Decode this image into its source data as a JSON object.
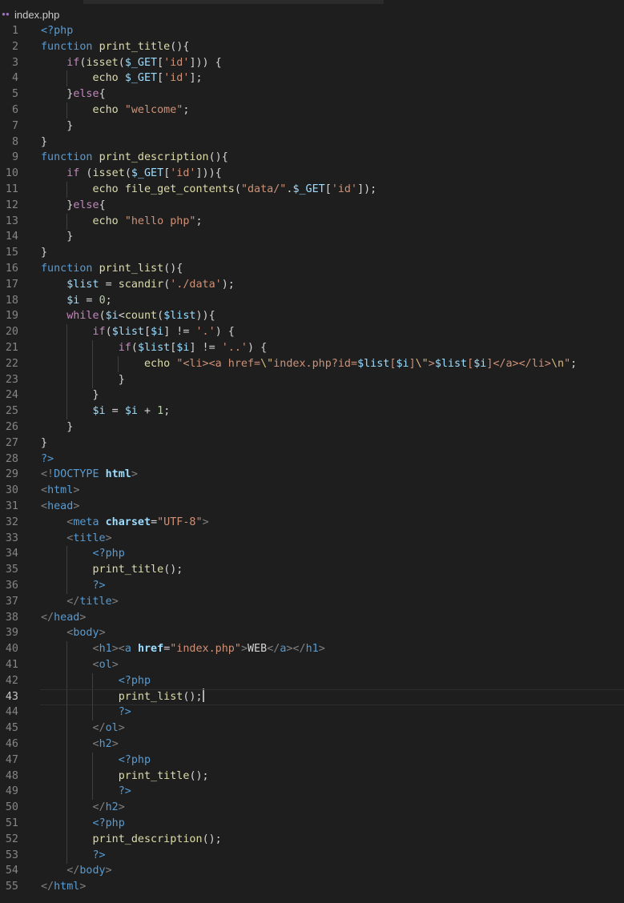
{
  "tab": {
    "icon": "php-elephant-icon",
    "title": "index.php"
  },
  "editor": {
    "language": "php",
    "active_line": 43,
    "lines": [
      [
        [
          "kw",
          "<?php"
        ]
      ],
      [
        [
          "kw",
          "function"
        ],
        [
          "plain",
          " "
        ],
        [
          "fn",
          "print_title"
        ],
        [
          "plain",
          "(){"
        ]
      ],
      [
        [
          "plain",
          "    "
        ],
        [
          "ctl",
          "if"
        ],
        [
          "plain",
          "("
        ],
        [
          "fn",
          "isset"
        ],
        [
          "plain",
          "("
        ],
        [
          "var",
          "$_GET"
        ],
        [
          "plain",
          "["
        ],
        [
          "str",
          "'id'"
        ],
        [
          "plain",
          "])) {"
        ]
      ],
      [
        [
          "plain",
          "        "
        ],
        [
          "fn",
          "echo"
        ],
        [
          "plain",
          " "
        ],
        [
          "var",
          "$_GET"
        ],
        [
          "plain",
          "["
        ],
        [
          "str",
          "'id'"
        ],
        [
          "plain",
          "];"
        ]
      ],
      [
        [
          "plain",
          "    }"
        ],
        [
          "ctl",
          "else"
        ],
        [
          "plain",
          "{"
        ]
      ],
      [
        [
          "plain",
          "        "
        ],
        [
          "fn",
          "echo"
        ],
        [
          "plain",
          " "
        ],
        [
          "str",
          "\"welcome\""
        ],
        [
          "plain",
          ";"
        ]
      ],
      [
        [
          "plain",
          "    }"
        ]
      ],
      [
        [
          "plain",
          "}"
        ]
      ],
      [
        [
          "kw",
          "function"
        ],
        [
          "plain",
          " "
        ],
        [
          "fn",
          "print_description"
        ],
        [
          "plain",
          "(){"
        ]
      ],
      [
        [
          "plain",
          "    "
        ],
        [
          "ctl",
          "if"
        ],
        [
          "plain",
          " ("
        ],
        [
          "fn",
          "isset"
        ],
        [
          "plain",
          "("
        ],
        [
          "var",
          "$_GET"
        ],
        [
          "plain",
          "["
        ],
        [
          "str",
          "'id'"
        ],
        [
          "plain",
          "])){"
        ]
      ],
      [
        [
          "plain",
          "        "
        ],
        [
          "fn",
          "echo"
        ],
        [
          "plain",
          " "
        ],
        [
          "fn",
          "file_get_contents"
        ],
        [
          "plain",
          "("
        ],
        [
          "str",
          "\"data/\""
        ],
        [
          "plain",
          "."
        ],
        [
          "var",
          "$_GET"
        ],
        [
          "plain",
          "["
        ],
        [
          "str",
          "'id'"
        ],
        [
          "plain",
          "]);"
        ]
      ],
      [
        [
          "plain",
          "    }"
        ],
        [
          "ctl",
          "else"
        ],
        [
          "plain",
          "{"
        ]
      ],
      [
        [
          "plain",
          "        "
        ],
        [
          "fn",
          "echo"
        ],
        [
          "plain",
          " "
        ],
        [
          "str",
          "\"hello php\""
        ],
        [
          "plain",
          ";"
        ]
      ],
      [
        [
          "plain",
          "    }"
        ]
      ],
      [
        [
          "plain",
          "}"
        ]
      ],
      [
        [
          "kw",
          "function"
        ],
        [
          "plain",
          " "
        ],
        [
          "fn",
          "print_list"
        ],
        [
          "plain",
          "(){"
        ]
      ],
      [
        [
          "plain",
          "    "
        ],
        [
          "var",
          "$list"
        ],
        [
          "plain",
          " = "
        ],
        [
          "fn",
          "scandir"
        ],
        [
          "plain",
          "("
        ],
        [
          "str",
          "'./data'"
        ],
        [
          "plain",
          ");"
        ]
      ],
      [
        [
          "plain",
          "    "
        ],
        [
          "var",
          "$i"
        ],
        [
          "plain",
          " = "
        ],
        [
          "num",
          "0"
        ],
        [
          "plain",
          ";"
        ]
      ],
      [
        [
          "plain",
          "    "
        ],
        [
          "ctl",
          "while"
        ],
        [
          "plain",
          "("
        ],
        [
          "var",
          "$i"
        ],
        [
          "plain",
          "<"
        ],
        [
          "fn",
          "count"
        ],
        [
          "plain",
          "("
        ],
        [
          "var",
          "$list"
        ],
        [
          "plain",
          ")){"
        ]
      ],
      [
        [
          "plain",
          "        "
        ],
        [
          "ctl",
          "if"
        ],
        [
          "plain",
          "("
        ],
        [
          "var",
          "$list"
        ],
        [
          "plain",
          "["
        ],
        [
          "var",
          "$i"
        ],
        [
          "plain",
          "] != "
        ],
        [
          "str",
          "'.'"
        ],
        [
          "plain",
          ") {"
        ]
      ],
      [
        [
          "plain",
          "            "
        ],
        [
          "ctl",
          "if"
        ],
        [
          "plain",
          "("
        ],
        [
          "var",
          "$list"
        ],
        [
          "plain",
          "["
        ],
        [
          "var",
          "$i"
        ],
        [
          "plain",
          "] != "
        ],
        [
          "str",
          "'..'"
        ],
        [
          "plain",
          ") {"
        ]
      ],
      [
        [
          "plain",
          "                "
        ],
        [
          "fn",
          "echo"
        ],
        [
          "plain",
          " "
        ],
        [
          "str",
          "\"<li><a href="
        ],
        [
          "esc",
          "\\\""
        ],
        [
          "str",
          "index.php?id="
        ],
        [
          "var",
          "$list"
        ],
        [
          "str",
          "["
        ],
        [
          "var",
          "$i"
        ],
        [
          "str",
          "]"
        ],
        [
          "esc",
          "\\\""
        ],
        [
          "str",
          ">"
        ],
        [
          "var",
          "$list"
        ],
        [
          "str",
          "["
        ],
        [
          "var",
          "$i"
        ],
        [
          "str",
          "]</a></li>"
        ],
        [
          "esc",
          "\\n"
        ],
        [
          "str",
          "\""
        ],
        [
          "plain",
          ";"
        ]
      ],
      [
        [
          "plain",
          "            }"
        ]
      ],
      [
        [
          "plain",
          "        }"
        ]
      ],
      [
        [
          "plain",
          "        "
        ],
        [
          "var",
          "$i"
        ],
        [
          "plain",
          " = "
        ],
        [
          "var",
          "$i"
        ],
        [
          "plain",
          " + "
        ],
        [
          "num",
          "1"
        ],
        [
          "plain",
          ";"
        ]
      ],
      [
        [
          "plain",
          "    }"
        ]
      ],
      [
        [
          "plain",
          "}"
        ]
      ],
      [
        [
          "kw",
          "?>"
        ]
      ],
      [
        [
          "br",
          "<!"
        ],
        [
          "tag",
          "DOCTYPE"
        ],
        [
          "plain",
          " "
        ],
        [
          "attr",
          "html"
        ],
        [
          "br",
          ">"
        ]
      ],
      [
        [
          "br",
          "<"
        ],
        [
          "tag",
          "html"
        ],
        [
          "br",
          ">"
        ]
      ],
      [
        [
          "br",
          "<"
        ],
        [
          "tag",
          "head"
        ],
        [
          "br",
          ">"
        ]
      ],
      [
        [
          "plain",
          "    "
        ],
        [
          "br",
          "<"
        ],
        [
          "tag",
          "meta"
        ],
        [
          "plain",
          " "
        ],
        [
          "attr",
          "charset"
        ],
        [
          "plain",
          "="
        ],
        [
          "str",
          "\"UTF-8\""
        ],
        [
          "br",
          ">"
        ]
      ],
      [
        [
          "plain",
          "    "
        ],
        [
          "br",
          "<"
        ],
        [
          "tag",
          "title"
        ],
        [
          "br",
          ">"
        ]
      ],
      [
        [
          "plain",
          "        "
        ],
        [
          "kw",
          "<?php"
        ]
      ],
      [
        [
          "plain",
          "        "
        ],
        [
          "fn",
          "print_title"
        ],
        [
          "plain",
          "();"
        ]
      ],
      [
        [
          "plain",
          "        "
        ],
        [
          "kw",
          "?>"
        ]
      ],
      [
        [
          "plain",
          "    "
        ],
        [
          "br",
          "</"
        ],
        [
          "tag",
          "title"
        ],
        [
          "br",
          ">"
        ]
      ],
      [
        [
          "br",
          "</"
        ],
        [
          "tag",
          "head"
        ],
        [
          "br",
          ">"
        ]
      ],
      [
        [
          "plain",
          "    "
        ],
        [
          "br",
          "<"
        ],
        [
          "tag",
          "body"
        ],
        [
          "br",
          ">"
        ]
      ],
      [
        [
          "plain",
          "        "
        ],
        [
          "br",
          "<"
        ],
        [
          "tag",
          "h1"
        ],
        [
          "br",
          "><"
        ],
        [
          "tag",
          "a"
        ],
        [
          "plain",
          " "
        ],
        [
          "attr",
          "href"
        ],
        [
          "plain",
          "="
        ],
        [
          "str",
          "\"index.php\""
        ],
        [
          "br",
          ">"
        ],
        [
          "plain",
          "WEB"
        ],
        [
          "br",
          "</"
        ],
        [
          "tag",
          "a"
        ],
        [
          "br",
          "></"
        ],
        [
          "tag",
          "h1"
        ],
        [
          "br",
          ">"
        ]
      ],
      [
        [
          "plain",
          "        "
        ],
        [
          "br",
          "<"
        ],
        [
          "tag",
          "ol"
        ],
        [
          "br",
          ">"
        ]
      ],
      [
        [
          "plain",
          "            "
        ],
        [
          "kw",
          "<?php"
        ]
      ],
      [
        [
          "plain",
          "            "
        ],
        [
          "fn",
          "print_list"
        ],
        [
          "plain",
          "();"
        ]
      ],
      [
        [
          "plain",
          "            "
        ],
        [
          "kw",
          "?>"
        ]
      ],
      [
        [
          "plain",
          "        "
        ],
        [
          "br",
          "</"
        ],
        [
          "tag",
          "ol"
        ],
        [
          "br",
          ">"
        ]
      ],
      [
        [
          "plain",
          "        "
        ],
        [
          "br",
          "<"
        ],
        [
          "tag",
          "h2"
        ],
        [
          "br",
          ">"
        ]
      ],
      [
        [
          "plain",
          "            "
        ],
        [
          "kw",
          "<?php"
        ]
      ],
      [
        [
          "plain",
          "            "
        ],
        [
          "fn",
          "print_title"
        ],
        [
          "plain",
          "();"
        ]
      ],
      [
        [
          "plain",
          "            "
        ],
        [
          "kw",
          "?>"
        ]
      ],
      [
        [
          "plain",
          "        "
        ],
        [
          "br",
          "</"
        ],
        [
          "tag",
          "h2"
        ],
        [
          "br",
          ">"
        ]
      ],
      [
        [
          "plain",
          "        "
        ],
        [
          "kw",
          "<?php"
        ]
      ],
      [
        [
          "plain",
          "        "
        ],
        [
          "fn",
          "print_description"
        ],
        [
          "plain",
          "();"
        ]
      ],
      [
        [
          "plain",
          "        "
        ],
        [
          "kw",
          "?>"
        ]
      ],
      [
        [
          "plain",
          "    "
        ],
        [
          "br",
          "</"
        ],
        [
          "tag",
          "body"
        ],
        [
          "br",
          ">"
        ]
      ],
      [
        [
          "br",
          "</"
        ],
        [
          "tag",
          "html"
        ],
        [
          "br",
          ">"
        ]
      ]
    ]
  }
}
